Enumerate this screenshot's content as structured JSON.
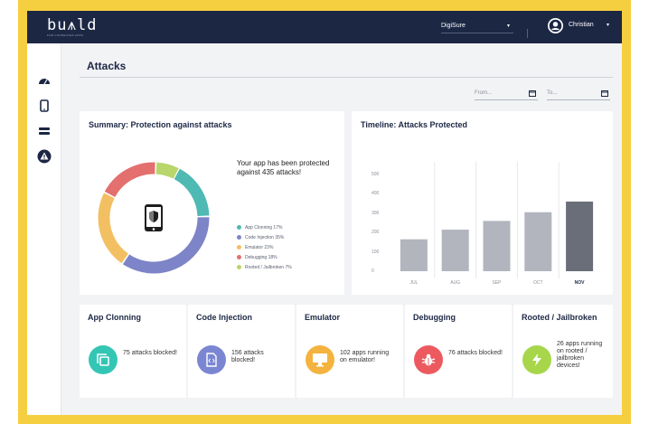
{
  "app": {
    "logo": "bu⩚ld",
    "logo_sub": "FOR CONNECTED APPS"
  },
  "topbar": {
    "tenant": "DigiSure",
    "tenant_caret": "▾",
    "user": "Christian",
    "user_caret": "▾"
  },
  "sidebar": {
    "items": [
      {
        "icon": "dashboard-icon"
      },
      {
        "icon": "mobile-device-icon"
      },
      {
        "icon": "server-icon"
      },
      {
        "icon": "alert-icon",
        "active": true
      }
    ]
  },
  "page": {
    "title": "Attacks"
  },
  "filters": {
    "from_placeholder": "From...",
    "to_placeholder": "To..."
  },
  "summary": {
    "title": "Summary: Protection against attacks",
    "text": "Your app has been protected against 435 attacks!",
    "legend": [
      {
        "label": "App Clonning 17%",
        "color": "#4fb9b3"
      },
      {
        "label": "Code Injection 35%",
        "color": "#7d84c7"
      },
      {
        "label": "Emulator 23%",
        "color": "#f2c062"
      },
      {
        "label": "Debugging 18%",
        "color": "#e46f6f"
      },
      {
        "label": "Rooted / Jailbroken 7%",
        "color": "#b8d66a"
      }
    ],
    "chart_data": {
      "type": "pie",
      "categories": [
        "App Clonning",
        "Code Injection",
        "Emulator",
        "Debugging",
        "Rooted / Jailbroken"
      ],
      "values": [
        17,
        35,
        23,
        18,
        7
      ],
      "colors": [
        "#4fb9b3",
        "#7d84c7",
        "#f2c062",
        "#e46f6f",
        "#b8d66a"
      ],
      "style": "donut"
    }
  },
  "timeline": {
    "title": "Timeline: Attacks Protected",
    "chart_data": {
      "type": "bar",
      "categories": [
        "JUL",
        "AUG",
        "SEP",
        "OCT",
        "NOV"
      ],
      "values": [
        165,
        215,
        260,
        305,
        360
      ],
      "yticks": [
        "0",
        "100",
        "200",
        "300",
        "400",
        "500"
      ],
      "ylim": [
        0,
        500
      ],
      "highlight_index": 4,
      "colors": {
        "bar": "#b2b5be",
        "highlight": "#6a6e78"
      },
      "grid": true
    }
  },
  "stats": [
    {
      "title": "App Clonning",
      "text": "75 attacks blocked!",
      "color": "#34c6b5",
      "icon": "copy-icon"
    },
    {
      "title": "Code Injection",
      "text": "156 attacks blocked!",
      "color": "#7b86d3",
      "icon": "code-file-icon"
    },
    {
      "title": "Emulator",
      "text": "102 apps running on emulator!",
      "color": "#f4b33f",
      "icon": "monitor-icon"
    },
    {
      "title": "Debugging",
      "text": "76 attacks blocked!",
      "color": "#ec5a60",
      "icon": "bug-icon"
    },
    {
      "title": "Rooted / Jailbroken",
      "text": "26 apps running on rooted / jailbroken devices!",
      "color": "#a7d64a",
      "icon": "lightning-icon"
    }
  ]
}
